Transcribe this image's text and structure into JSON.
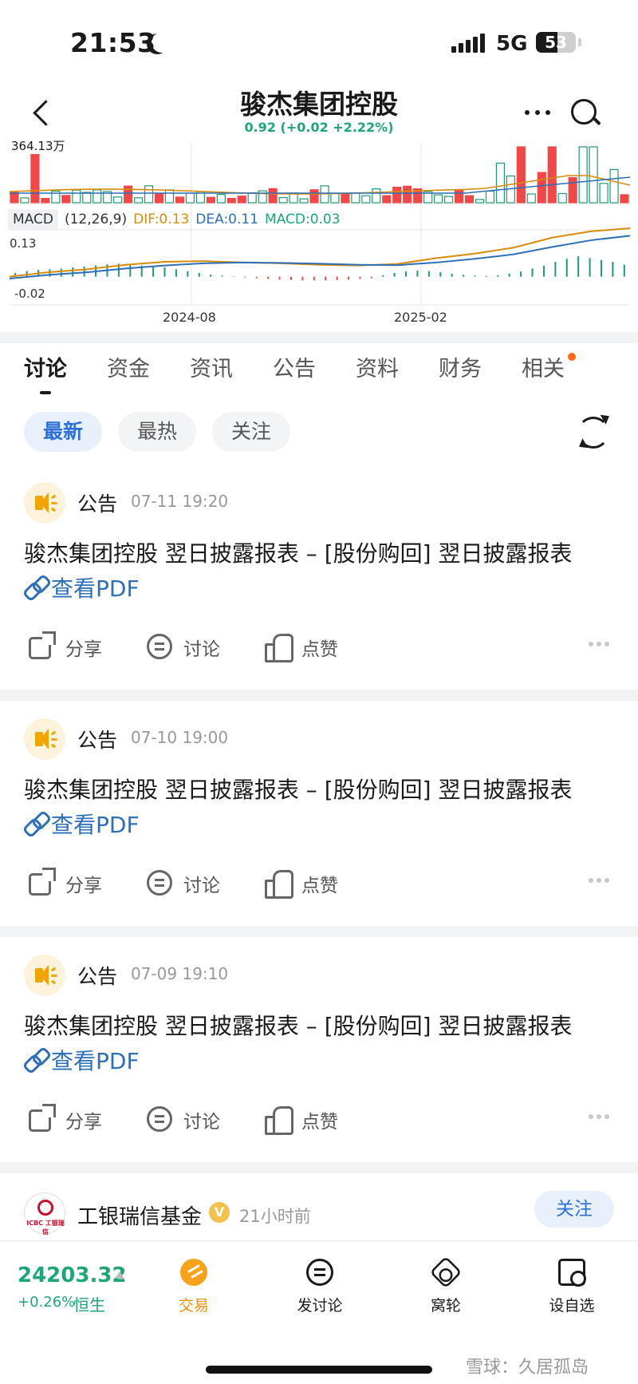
{
  "status": {
    "time": "21:53",
    "network": "5G",
    "battery": "53"
  },
  "header": {
    "title": "骏杰集团控股",
    "price_line": "0.92 (+0.02 +2.22%)"
  },
  "chart": {
    "volume_label": "364.13万",
    "macd": {
      "tag": "MACD",
      "params": "(12,26,9)",
      "dif": "DIF:0.13",
      "dea": "DEA:0.11",
      "macd": "MACD:0.03",
      "max_label": "0.13",
      "min_label": "-0.02"
    },
    "dates": [
      "2024-08",
      "2025-02"
    ],
    "colors": {
      "up": "#f04848",
      "down": "#1f9a72",
      "dif": "#d98c0b",
      "dea": "#2e6fb8"
    }
  },
  "chart_data": {
    "type": "bar",
    "title": "",
    "xlabel": "",
    "ylabel": "",
    "x_ticks": [
      "2024-08",
      "2025-02"
    ],
    "ylim": [
      -0.02,
      0.13
    ],
    "series": [
      {
        "name": "MACD",
        "values": [
          0.01,
          0.015,
          0.018,
          0.02,
          0.022,
          0.025,
          0.027,
          0.03,
          0.033,
          0.035,
          0.033,
          0.03,
          0.028,
          0.025,
          0.02,
          0.015,
          0.01,
          0.006,
          0.003,
          0.001,
          -0.002,
          -0.004,
          -0.006,
          -0.008,
          -0.009,
          -0.01,
          -0.01,
          -0.01,
          -0.009,
          -0.008,
          -0.006,
          -0.004,
          0.004,
          0.01,
          0.014,
          0.016,
          0.015,
          0.012,
          0.008,
          0.005,
          0.003,
          0.002,
          0.004,
          0.008,
          0.014,
          0.022,
          0.03,
          0.04,
          0.048,
          0.055,
          0.05,
          0.045,
          0.04,
          0.032
        ]
      },
      {
        "name": "DIF",
        "values": [
          0.0,
          0.012,
          0.02,
          0.032,
          0.04,
          0.042,
          0.038,
          0.036,
          0.032,
          0.03,
          0.034,
          0.05,
          0.062,
          0.078,
          0.105,
          0.122,
          0.13
        ]
      },
      {
        "name": "DEA",
        "values": [
          -0.005,
          0.005,
          0.012,
          0.022,
          0.03,
          0.036,
          0.038,
          0.037,
          0.035,
          0.032,
          0.031,
          0.038,
          0.048,
          0.06,
          0.08,
          0.098,
          0.11
        ]
      }
    ]
  },
  "tabs": [
    "讨论",
    "资金",
    "资讯",
    "公告",
    "资料",
    "财务",
    "相关"
  ],
  "filters": [
    "最新",
    "最热",
    "关注"
  ],
  "posts": [
    {
      "author": "公告",
      "time": "07-11 19:20",
      "text": "骏杰集团控股 翌日披露报表 – [股份购回] 翌日披露报表",
      "link": "查看PDF",
      "share": "分享",
      "comment": "讨论",
      "like": "点赞"
    },
    {
      "author": "公告",
      "time": "07-10 19:00",
      "text": "骏杰集团控股 翌日披露报表 – [股份购回] 翌日披露报表",
      "link": "查看PDF",
      "share": "分享",
      "comment": "讨论",
      "like": "点赞"
    },
    {
      "author": "公告",
      "time": "07-09 19:10",
      "text": "骏杰集团控股 翌日披露报表 – [股份购回] 翌日披露报表",
      "link": "查看PDF",
      "share": "分享",
      "comment": "讨论",
      "like": "点赞"
    }
  ],
  "post4": {
    "author": "工银瑞信基金",
    "badge": "V",
    "time": "21小时前",
    "follow": "关注",
    "logo_text": "ICBC 工银瑞信"
  },
  "bottom": {
    "index_value": "24203.32",
    "index_change": "+0.26%",
    "index_name": "恒生",
    "nav": [
      "交易",
      "发讨论",
      "窝轮",
      "设自选"
    ],
    "watermark": "雪球：久居孤岛"
  }
}
